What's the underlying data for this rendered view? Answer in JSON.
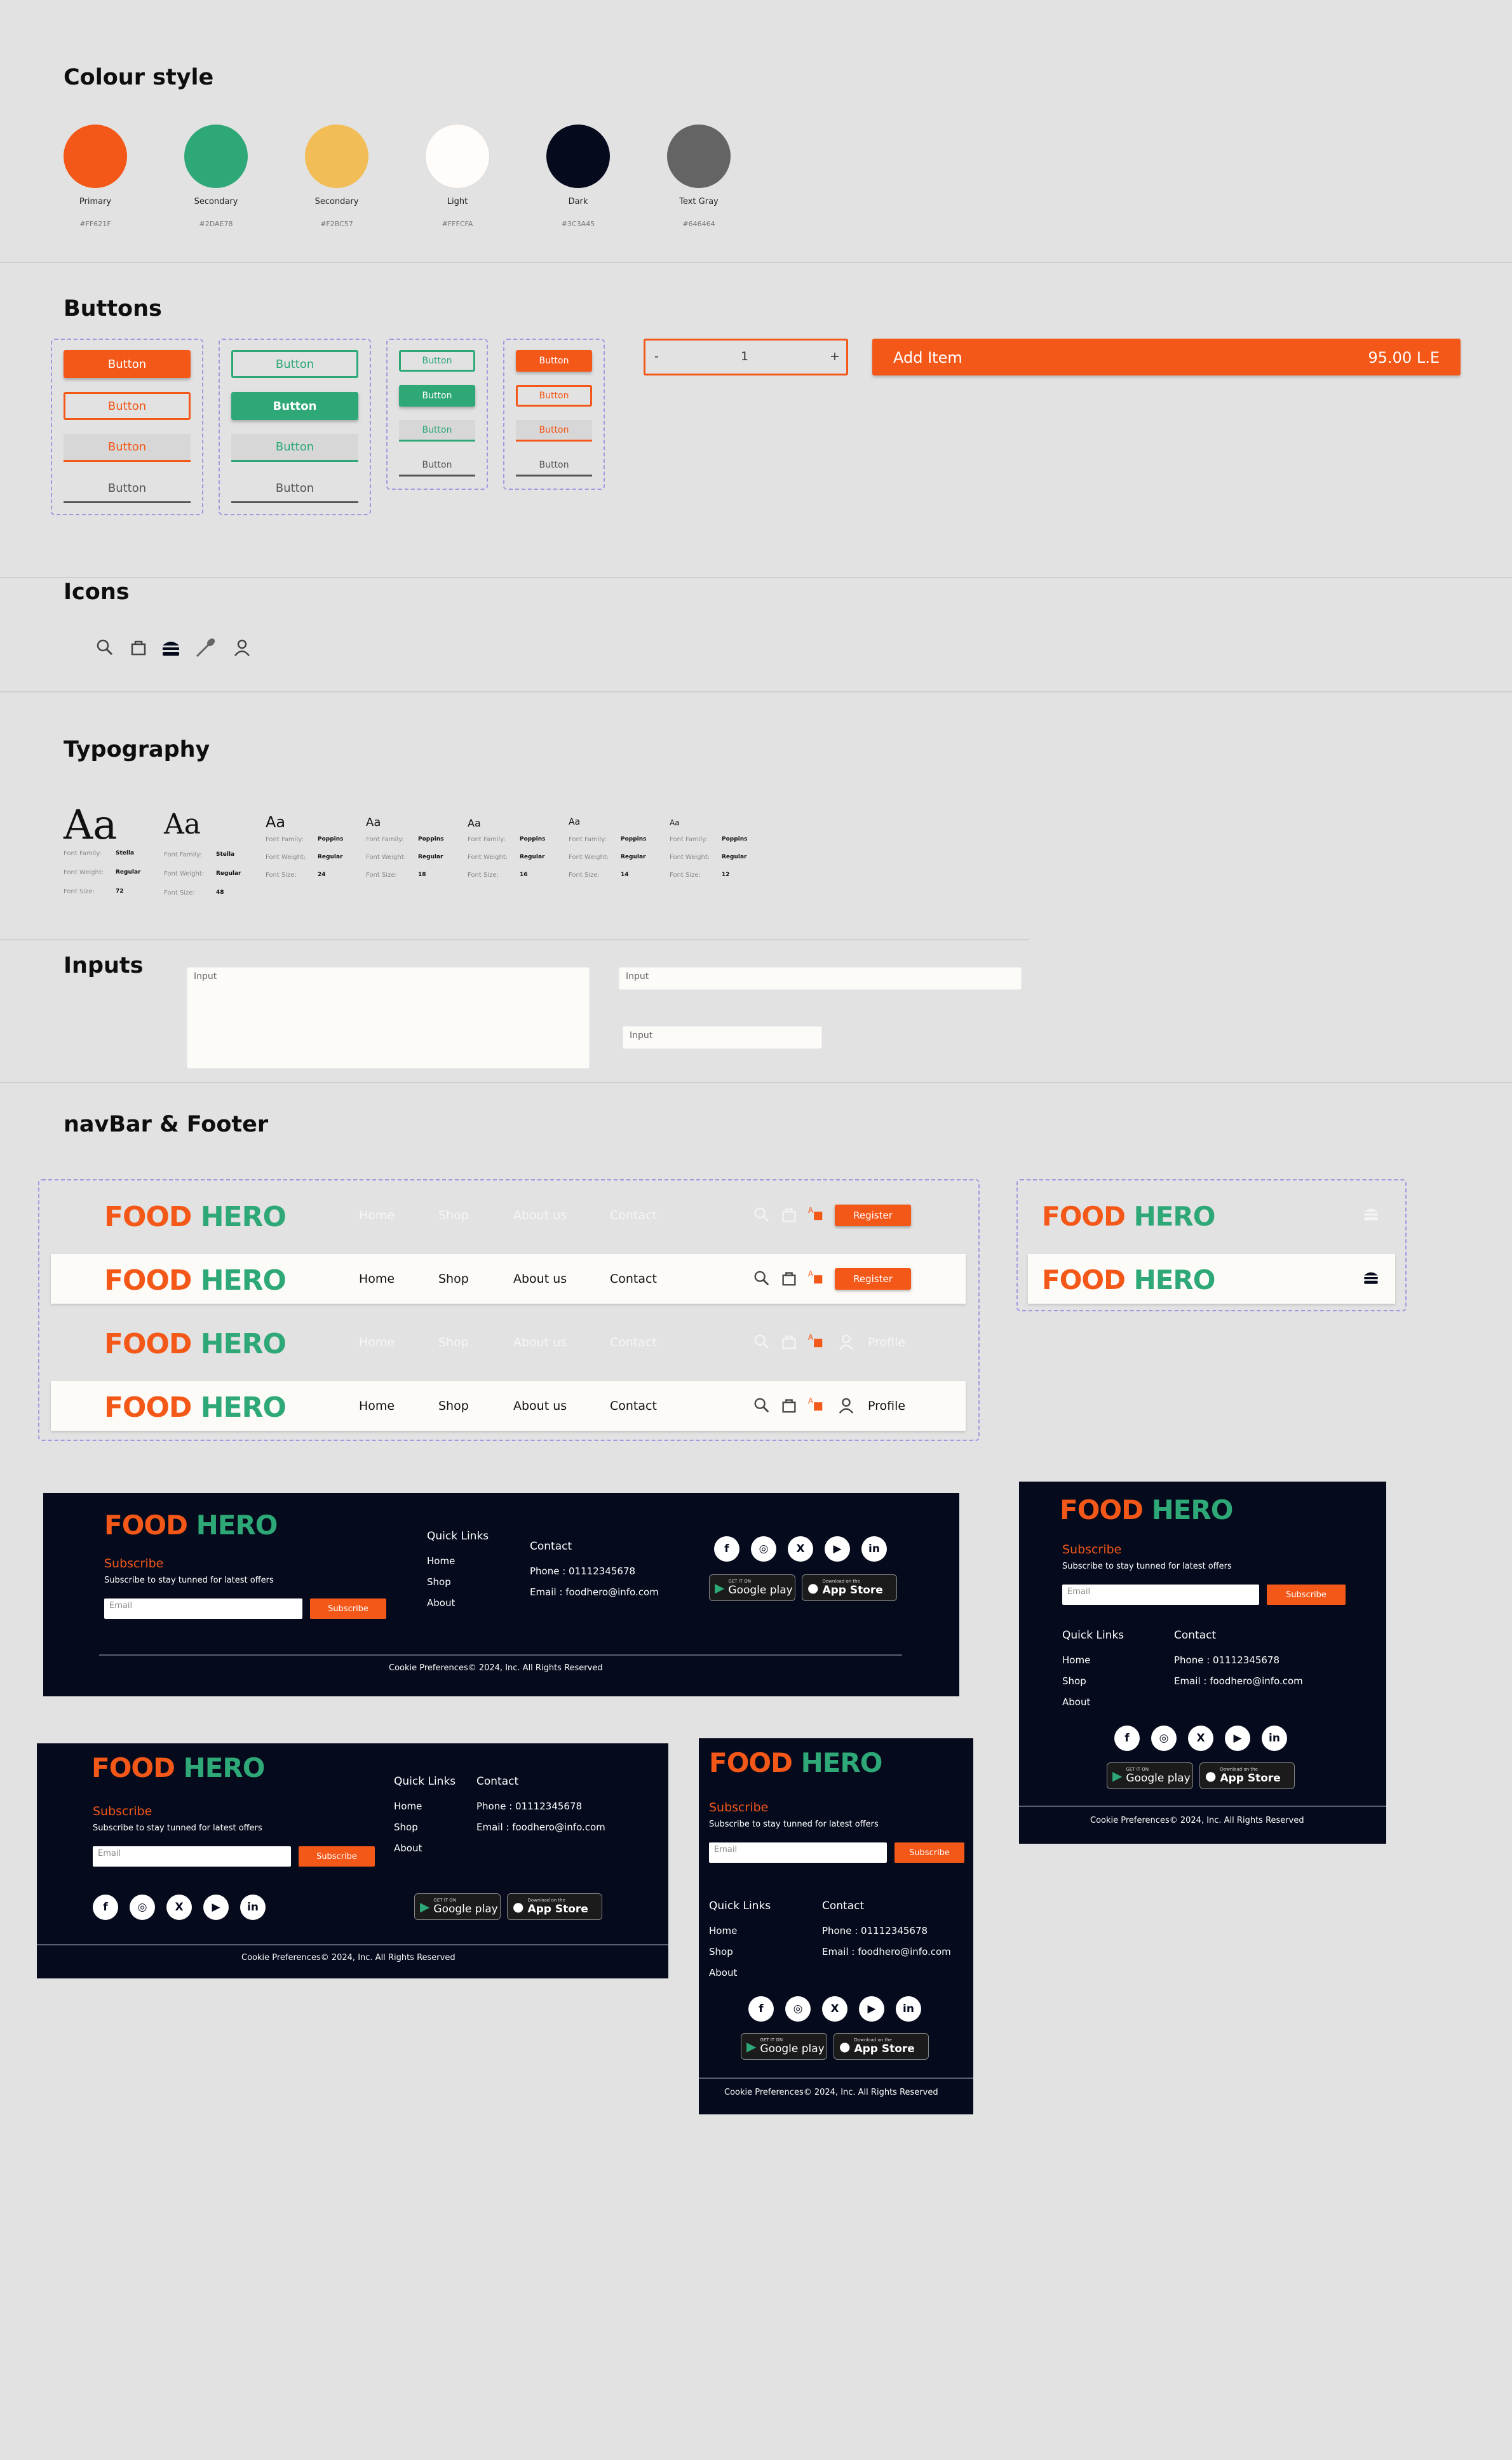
{
  "colour_style": {
    "title": "Colour style",
    "swatches": [
      {
        "name": "Primary",
        "hex": "#FF621F",
        "color": "#f45819"
      },
      {
        "name": "Secondary",
        "hex": "#2DAE78",
        "color": "#2da876"
      },
      {
        "name": "Secondary",
        "hex": "#F2BC57",
        "color": "#f2bc57"
      },
      {
        "name": "Light",
        "hex": "#FFFCFA",
        "color": "#fffcfa"
      },
      {
        "name": "Dark",
        "hex": "#3C3A45",
        "color": "#050a1c"
      },
      {
        "name": "Text Gray",
        "hex": "#646464",
        "color": "#646464"
      }
    ]
  },
  "buttons": {
    "title": "Buttons",
    "label": "Button",
    "stepper": {
      "minus": "-",
      "value": "1",
      "plus": "+"
    },
    "add_item": {
      "label": "Add Item",
      "price": "95.00 L.E"
    }
  },
  "icons": {
    "title": "Icons",
    "items": [
      "search-icon",
      "cart-icon",
      "burger-menu-icon",
      "spoon-icon",
      "user-icon"
    ]
  },
  "typography": {
    "title": "Typography",
    "sample": "Aa",
    "labels": {
      "family": "Font Family:",
      "weight": "Font Weight:",
      "size": "Font Size:"
    },
    "styles": [
      {
        "family": "Stella",
        "weight": "Regular",
        "size": "72"
      },
      {
        "family": "Stella",
        "weight": "Regular",
        "size": "48"
      },
      {
        "family": "Poppins",
        "weight": "Regular",
        "size": "24"
      },
      {
        "family": "Poppins",
        "weight": "Regular",
        "size": "18"
      },
      {
        "family": "Poppins",
        "weight": "Regular",
        "size": "16"
      },
      {
        "family": "Poppins",
        "weight": "Regular",
        "size": "14"
      },
      {
        "family": "Poppins",
        "weight": "Regular",
        "size": "12"
      }
    ]
  },
  "inputs": {
    "title": "Inputs",
    "placeholder": "Input"
  },
  "navbar": {
    "title": "navBar & Footer",
    "logo_food": "FOOD",
    "logo_hero": "HERO",
    "links": [
      "Home",
      "Shop",
      "About us",
      "Contact"
    ],
    "register": "Register",
    "profile": "Profile"
  },
  "footer": {
    "subscribe_title": "Subscribe",
    "subscribe_text": "Subscribe to stay tunned for latest offers",
    "email_placeholder": "Email",
    "subscribe_button": "Subscribe",
    "quick_links_title": "Quick Links",
    "quick_links": [
      "Home",
      "Shop",
      "About"
    ],
    "contact_title": "Contact",
    "phone": "Phone : 01112345678",
    "email": "Email : foodhero@info.com",
    "social": [
      "facebook-icon",
      "instagram-icon",
      "x-icon",
      "youtube-icon",
      "linkedin-icon"
    ],
    "google_play_small": "GET IT ON",
    "google_play": "Google play",
    "app_store_small": "Download on the",
    "app_store": "App Store",
    "copyright": "Cookie Preferences© 2024, Inc. All Rights Reserved"
  }
}
